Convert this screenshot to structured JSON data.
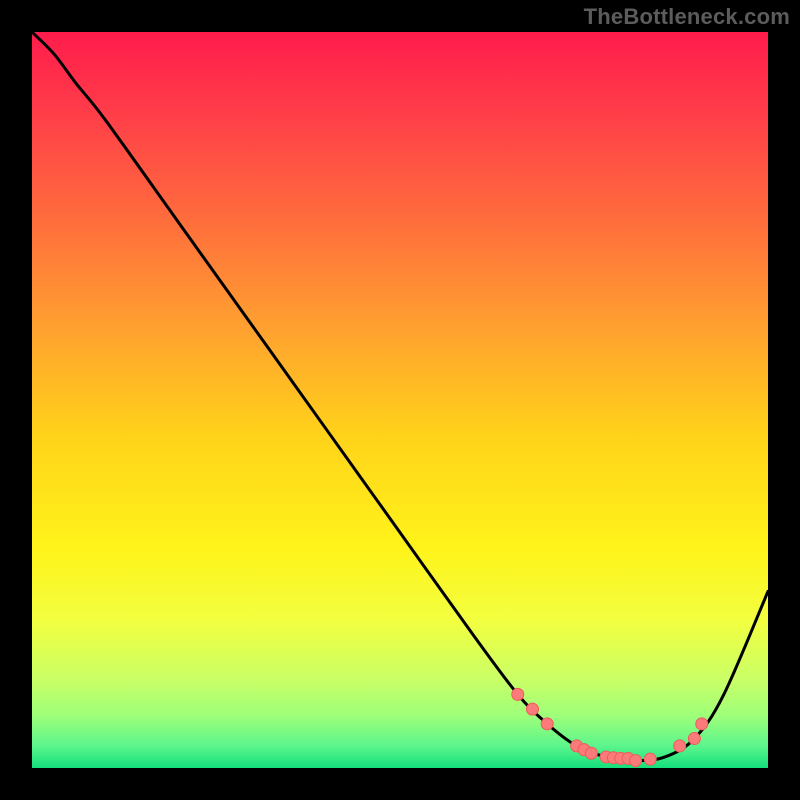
{
  "watermark": "TheBottleneck.com",
  "colors": {
    "bg": "#000000",
    "watermark": "#5c5c5c",
    "curve": "#000000",
    "marker_fill": "#fb7a7a",
    "marker_stroke": "#f05a5a"
  },
  "chart_data": {
    "type": "line",
    "title": "",
    "xlabel": "",
    "ylabel": "",
    "xlim": [
      0,
      100
    ],
    "ylim": [
      0,
      100
    ],
    "background_gradient_stops": [
      {
        "pos": 0.0,
        "color": "#ff1c4b"
      },
      {
        "pos": 0.1,
        "color": "#ff3a4a"
      },
      {
        "pos": 0.25,
        "color": "#ff6b3d"
      },
      {
        "pos": 0.4,
        "color": "#ffa030"
      },
      {
        "pos": 0.55,
        "color": "#ffd31a"
      },
      {
        "pos": 0.7,
        "color": "#fff31a"
      },
      {
        "pos": 0.8,
        "color": "#f2ff40"
      },
      {
        "pos": 0.88,
        "color": "#c9ff66"
      },
      {
        "pos": 0.93,
        "color": "#9dff7a"
      },
      {
        "pos": 0.97,
        "color": "#5cf58c"
      },
      {
        "pos": 1.0,
        "color": "#13e07c"
      }
    ],
    "series": [
      {
        "name": "bottleneck-curve",
        "x": [
          0,
          3,
          6,
          10,
          20,
          30,
          40,
          50,
          60,
          66,
          70,
          74,
          78,
          82,
          86,
          90,
          94,
          100
        ],
        "y": [
          100,
          97,
          93,
          88,
          74,
          60,
          46,
          32,
          18,
          10,
          6,
          3,
          1.5,
          1,
          1.5,
          4,
          10,
          24
        ]
      }
    ],
    "markers": {
      "name": "fit-zone-dots",
      "x": [
        66,
        68,
        70,
        74,
        75,
        76,
        78,
        79,
        80,
        81,
        82,
        84,
        88,
        90,
        91
      ],
      "y": [
        10,
        8,
        6,
        3,
        2.5,
        2,
        1.5,
        1.4,
        1.3,
        1.3,
        1.0,
        1.2,
        3,
        4,
        6
      ]
    }
  }
}
